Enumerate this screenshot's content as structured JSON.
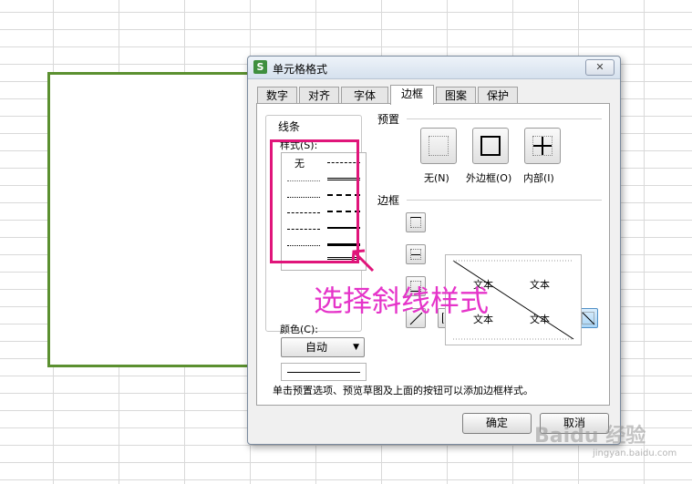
{
  "dialog": {
    "title": "单元格格式",
    "app_icon": "S",
    "close_label": "✕",
    "tabs": [
      "数字",
      "对齐",
      "字体",
      "边框",
      "图案",
      "保护"
    ],
    "active_tab": "边框"
  },
  "line": {
    "group_title": "线条",
    "style_label": "样式(S):",
    "none_option": "无",
    "color_label": "颜色(C):",
    "color_value": "自动"
  },
  "presets": {
    "section_label": "预置",
    "none": "无(N)",
    "outline": "外边框(O)",
    "inside": "内部(I)"
  },
  "border": {
    "section_label": "边框",
    "preview_text": [
      "文本",
      "文本",
      "文本",
      "文本"
    ]
  },
  "hint": "单击预置选项、预览草图及上面的按钮可以添加边框样式。",
  "buttons": {
    "ok": "确定",
    "cancel": "取消"
  },
  "annotation": "选择斜线样式",
  "watermark": {
    "main": "Baidu 经验",
    "sub": "jingyan.baidu.com"
  },
  "colors": {
    "highlight": "#e0157a",
    "annotation": "#e534c9",
    "selection": "#5b9030",
    "active_toggle": "#a8d4f5"
  }
}
